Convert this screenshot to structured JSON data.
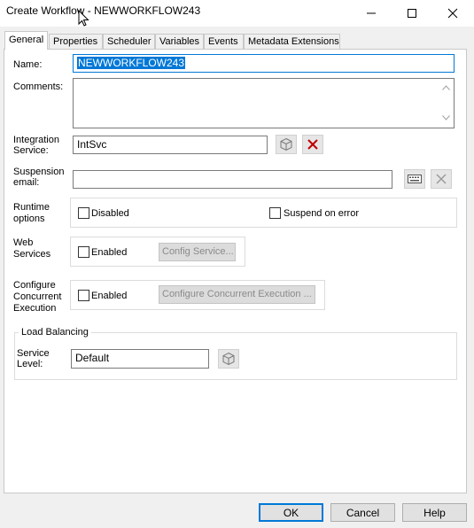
{
  "window": {
    "title": "Create Workflow - NEWWORKFLOW243"
  },
  "tabs": [
    {
      "label": "General"
    },
    {
      "label": "Properties"
    },
    {
      "label": "Scheduler"
    },
    {
      "label": "Variables"
    },
    {
      "label": "Events"
    },
    {
      "label": "Metadata Extensions"
    }
  ],
  "form": {
    "name_label": "Name:",
    "name_value": "NEWWORKFLOW243",
    "comments_label": "Comments:",
    "comments_value": "",
    "integration_service_label_1": "Integration",
    "integration_service_label_2": "Service:",
    "integration_service_value": "IntSvc",
    "suspension_email_label_1": "Suspension",
    "suspension_email_label_2": "email:",
    "suspension_email_value": "",
    "runtime_options_label_1": "Runtime",
    "runtime_options_label_2": "options",
    "disabled_label": "Disabled",
    "suspend_on_error_label": "Suspend on error",
    "web_services_label_1": "Web",
    "web_services_label_2": "Services",
    "web_enabled_label": "Enabled",
    "config_service_label": "Config Service...",
    "configure_concurrent_label_1": "Configure",
    "configure_concurrent_label_2": "Concurrent",
    "configure_concurrent_label_3": "Execution",
    "concurrent_enabled_label": "Enabled",
    "configure_concurrent_button": "Configure Concurrent Execution ...",
    "load_balancing_label": "Load Balancing",
    "service_level_label_1": "Service",
    "service_level_label_2": "Level:",
    "service_level_value": "Default"
  },
  "buttons": {
    "ok": "OK",
    "cancel": "Cancel",
    "help": "Help"
  },
  "colors": {
    "selection": "#0078d7",
    "delete_icon": "#c00000",
    "disabled_text": "#8a8a8a"
  }
}
